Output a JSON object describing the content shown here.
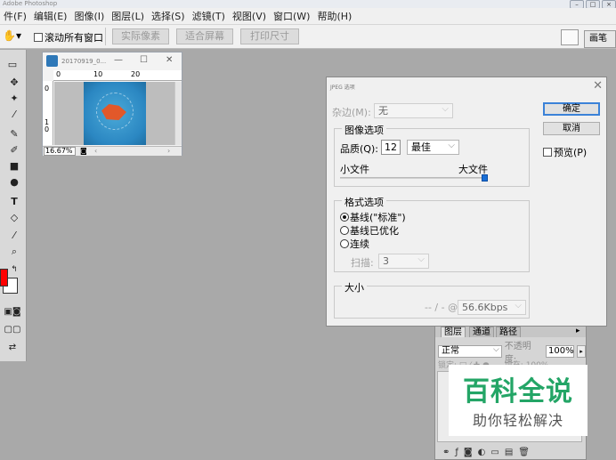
{
  "app": {
    "title": "Adobe Photoshop"
  },
  "menu": [
    "件(F)",
    "编辑(E)",
    "图像(I)",
    "图层(L)",
    "选择(S)",
    "滤镜(T)",
    "视图(V)",
    "窗口(W)",
    "帮助(H)"
  ],
  "options": {
    "scroll_all_label": "滚动所有窗口",
    "actual_pixels": "实际像素",
    "fit_screen": "适合屏幕",
    "print_size": "打印尺寸",
    "workspace_tab": "画笔"
  },
  "document": {
    "title": "20170919_0...",
    "zoom": "16.67%",
    "ruler_h": [
      "0",
      "10",
      "20"
    ],
    "ruler_v": [
      "0",
      "1",
      "0"
    ]
  },
  "dialog": {
    "title": "JPEG 选项",
    "matte_label": "杂边(M):",
    "matte_value": "无",
    "image_options_title": "图像选项",
    "quality_label": "品质(Q):",
    "quality_value": "12",
    "quality_preset": "最佳",
    "small_file": "小文件",
    "large_file": "大文件",
    "quality_level": 1.0,
    "format_options_title": "格式选项",
    "format_baseline_standard": "基线(\"标准\")",
    "format_baseline_optimized": "基线已优化",
    "format_progressive": "连续",
    "scans_label": "扫描:",
    "scans_value": "3",
    "size_title": "大小",
    "size_text": "-- / - @",
    "size_speed": "56.6Kbps",
    "ok": "确定",
    "cancel": "取消",
    "preview": "预览(P)"
  },
  "layers": {
    "tabs": [
      "图层",
      "通道",
      "路径"
    ],
    "blend_mode": "正常",
    "opacity_label": "不透明度:",
    "opacity_value": "100%",
    "lock_label": "锁定:",
    "fill_label": "填充:",
    "fill_value": "100%"
  },
  "watermark": {
    "title": "百科全说",
    "subtitle": "助你轻松解决"
  },
  "colors": {
    "foreground": "#ff0000",
    "background": "#ffffff",
    "accent": "#3b82d8",
    "watermark_green": "#23a566"
  }
}
